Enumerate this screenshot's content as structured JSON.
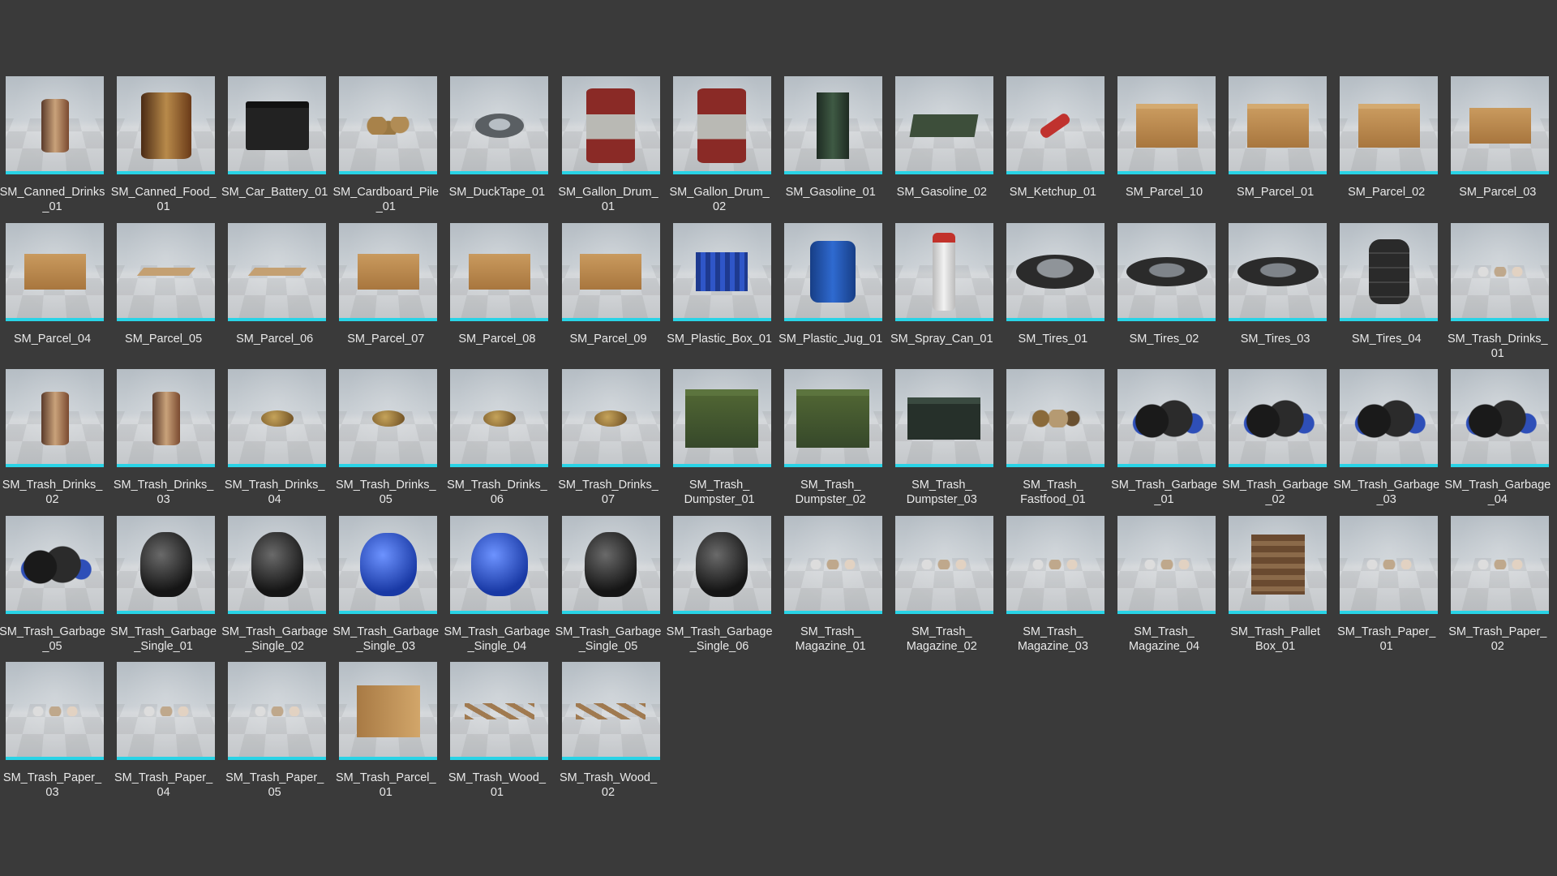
{
  "assets": [
    {
      "label": "SM_Canned_Drinks\n_01",
      "icon": "can-icon",
      "shape": "can"
    },
    {
      "label": "SM_Canned_Food_\n01",
      "icon": "food-can-icon",
      "shape": "can-big"
    },
    {
      "label": "SM_Car_Battery_01",
      "icon": "car-battery-icon",
      "shape": "battery"
    },
    {
      "label": "SM_Cardboard_Pile\n_01",
      "icon": "cardboard-pile-icon",
      "shape": "pile"
    },
    {
      "label": "SM_DuckTape_01",
      "icon": "duck-tape-icon",
      "shape": "tape"
    },
    {
      "label": "SM_Gallon_Drum_\n01",
      "icon": "drum-icon",
      "shape": "drum"
    },
    {
      "label": "SM_Gallon_Drum_\n02",
      "icon": "drum-icon",
      "shape": "drum"
    },
    {
      "label": "SM_Gasoline_01",
      "icon": "gasoline-can-icon",
      "shape": "gas"
    },
    {
      "label": "SM_Gasoline_02",
      "icon": "gasoline-can-icon",
      "shape": "gas-flat"
    },
    {
      "label": "SM_Ketchup_01",
      "icon": "ketchup-bottle-icon",
      "shape": "ketchup"
    },
    {
      "label": "SM_Parcel_10",
      "icon": "parcel-icon",
      "shape": "box"
    },
    {
      "label": "SM_Parcel_01",
      "icon": "parcel-icon",
      "shape": "box"
    },
    {
      "label": "SM_Parcel_02",
      "icon": "parcel-icon",
      "shape": "box"
    },
    {
      "label": "SM_Parcel_03",
      "icon": "parcel-icon",
      "shape": "box-open"
    },
    {
      "label": "SM_Parcel_04",
      "icon": "parcel-icon",
      "shape": "box-open"
    },
    {
      "label": "SM_Parcel_05",
      "icon": "flat-cardboard-icon",
      "shape": "flat"
    },
    {
      "label": "SM_Parcel_06",
      "icon": "flat-cardboard-icon",
      "shape": "flat"
    },
    {
      "label": "SM_Parcel_07",
      "icon": "parcel-icon",
      "shape": "box-open"
    },
    {
      "label": "SM_Parcel_08",
      "icon": "parcel-icon",
      "shape": "box-open"
    },
    {
      "label": "SM_Parcel_09",
      "icon": "parcel-icon",
      "shape": "box-open"
    },
    {
      "label": "SM_Plastic_Box_01",
      "icon": "plastic-crate-icon",
      "shape": "crate"
    },
    {
      "label": "SM_Plastic_Jug_01",
      "icon": "plastic-jug-icon",
      "shape": "jug"
    },
    {
      "label": "SM_Spray_Can_01",
      "icon": "spray-can-icon",
      "shape": "spray"
    },
    {
      "label": "SM_Tires_01",
      "icon": "tire-icon",
      "shape": "tire"
    },
    {
      "label": "SM_Tires_02",
      "icon": "tire-icon",
      "shape": "tire-flat"
    },
    {
      "label": "SM_Tires_03",
      "icon": "tire-icon",
      "shape": "tire-flat"
    },
    {
      "label": "SM_Tires_04",
      "icon": "tire-stack-icon",
      "shape": "tires-stack"
    },
    {
      "label": "SM_Trash_Drinks_\n01",
      "icon": "trash-drinks-icon",
      "shape": "paper"
    },
    {
      "label": "SM_Trash_Drinks_\n02",
      "icon": "can-icon",
      "shape": "can"
    },
    {
      "label": "SM_Trash_Drinks_\n03",
      "icon": "can-icon",
      "shape": "can"
    },
    {
      "label": "SM_Trash_Drinks_\n04",
      "icon": "crushed-can-icon",
      "shape": "crumple"
    },
    {
      "label": "SM_Trash_Drinks_\n05",
      "icon": "crushed-can-icon",
      "shape": "crumple"
    },
    {
      "label": "SM_Trash_Drinks_\n06",
      "icon": "crushed-can-icon",
      "shape": "crumple"
    },
    {
      "label": "SM_Trash_Drinks_\n07",
      "icon": "crushed-can-icon",
      "shape": "crumple"
    },
    {
      "label": "SM_Trash_\nDumpster_01",
      "icon": "dumpster-icon",
      "shape": "dumpster"
    },
    {
      "label": "SM_Trash_\nDumpster_02",
      "icon": "dumpster-icon",
      "shape": "dumpster"
    },
    {
      "label": "SM_Trash_\nDumpster_03",
      "icon": "dumpster-icon",
      "shape": "dumpster-low"
    },
    {
      "label": "SM_Trash_\nFastfood_01",
      "icon": "fastfood-trash-icon",
      "shape": "fastfood"
    },
    {
      "label": "SM_Trash_Garbage\n_01",
      "icon": "garbage-bags-icon",
      "shape": "bags"
    },
    {
      "label": "SM_Trash_Garbage\n_02",
      "icon": "garbage-bags-icon",
      "shape": "bags"
    },
    {
      "label": "SM_Trash_Garbage\n_03",
      "icon": "garbage-bags-icon",
      "shape": "bags"
    },
    {
      "label": "SM_Trash_Garbage\n_04",
      "icon": "garbage-bags-icon",
      "shape": "bags"
    },
    {
      "label": "SM_Trash_Garbage\n_05",
      "icon": "garbage-bags-icon",
      "shape": "bags"
    },
    {
      "label": "SM_Trash_Garbage\n_Single_01",
      "icon": "garbage-bag-icon",
      "shape": "bag-black"
    },
    {
      "label": "SM_Trash_Garbage\n_Single_02",
      "icon": "garbage-bag-icon",
      "shape": "bag-black"
    },
    {
      "label": "SM_Trash_Garbage\n_Single_03",
      "icon": "garbage-bag-blue-icon",
      "shape": "bag-blue"
    },
    {
      "label": "SM_Trash_Garbage\n_Single_04",
      "icon": "garbage-bag-blue-icon",
      "shape": "bag-blue"
    },
    {
      "label": "SM_Trash_Garbage\n_Single_05",
      "icon": "garbage-bag-icon",
      "shape": "bag-black"
    },
    {
      "label": "SM_Trash_Garbage\n_Single_06",
      "icon": "garbage-bag-icon",
      "shape": "bag-black"
    },
    {
      "label": "SM_Trash_\nMagazine_01",
      "icon": "magazine-icon",
      "shape": "paper"
    },
    {
      "label": "SM_Trash_\nMagazine_02",
      "icon": "magazine-icon",
      "shape": "paper"
    },
    {
      "label": "SM_Trash_\nMagazine_03",
      "icon": "magazine-icon",
      "shape": "paper"
    },
    {
      "label": "SM_Trash_\nMagazine_04",
      "icon": "magazine-icon",
      "shape": "paper"
    },
    {
      "label": "SM_Trash_Pallet\nBox_01",
      "icon": "pallet-box-icon",
      "shape": "pallet"
    },
    {
      "label": "SM_Trash_Paper_\n01",
      "icon": "paper-scraps-icon",
      "shape": "paper"
    },
    {
      "label": "SM_Trash_Paper_\n02",
      "icon": "paper-scraps-icon",
      "shape": "paper"
    },
    {
      "label": "SM_Trash_Paper_\n03",
      "icon": "paper-scraps-icon",
      "shape": "paper"
    },
    {
      "label": "SM_Trash_Paper_\n04",
      "icon": "paper-scraps-icon",
      "shape": "paper"
    },
    {
      "label": "SM_Trash_Paper_\n05",
      "icon": "paper-scraps-icon",
      "shape": "paper"
    },
    {
      "label": "SM_Trash_Parcel_\n01",
      "icon": "parcel-icon",
      "shape": "parcel-tall"
    },
    {
      "label": "SM_Trash_Wood_\n01",
      "icon": "wood-planks-icon",
      "shape": "wood"
    },
    {
      "label": "SM_Trash_Wood_\n02",
      "icon": "wood-planks-icon",
      "shape": "wood"
    }
  ],
  "colors": {
    "background": "#3a3a3a",
    "selection_bar": "#29d3e6",
    "label_text": "#e9e9e9"
  }
}
